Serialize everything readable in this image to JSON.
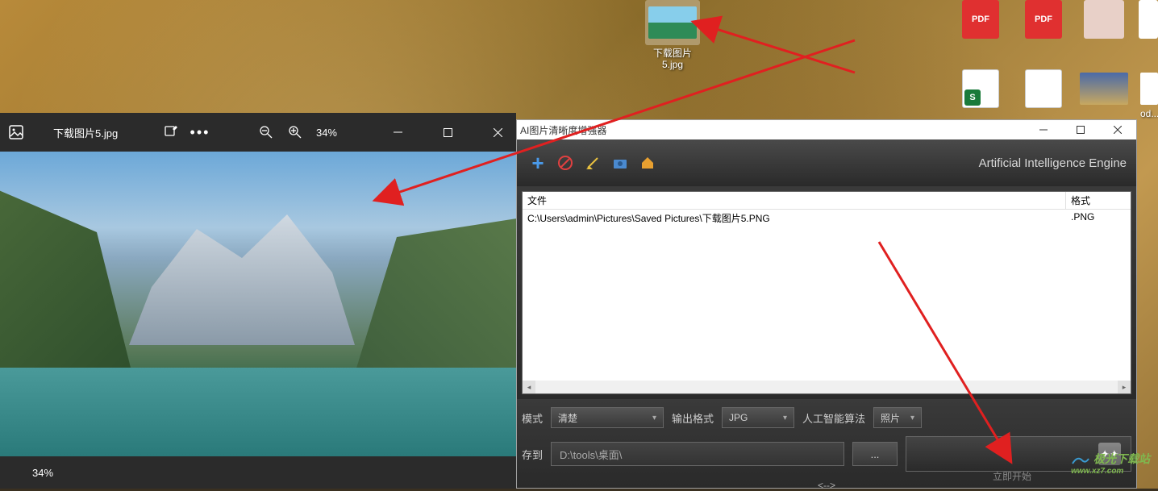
{
  "desktop": {
    "selected_icon": {
      "line1": "下载图片",
      "line2": "5.jpg"
    },
    "pdf_label": "PDF",
    "xls_label": "S",
    "od_label": "od..."
  },
  "viewer": {
    "filename": "下载图片5.jpg",
    "zoom_percent": "34%",
    "footer_zoom": "34%"
  },
  "ai": {
    "title": "AI图片清晰度增强器",
    "engine_label": "Artificial Intelligence Engine",
    "list": {
      "header_file": "文件",
      "header_format": "格式",
      "row_file": "C:\\Users\\admin\\Pictures\\Saved Pictures\\下载图片5.PNG",
      "row_format": ".PNG"
    },
    "mode_label": "模式",
    "mode_value": "清楚",
    "output_label": "输出格式",
    "output_value": "JPG",
    "algo_label": "人工智能算法",
    "algo_value": "照片",
    "save_to_label": "存到",
    "save_to_path": "D:\\tools\\桌面\\",
    "browse_dots": "...",
    "arrows_text": "<-->",
    "start_hint": "立即开始"
  },
  "watermark": {
    "main": "极光下载站",
    "sub": "www.xz7.com"
  }
}
